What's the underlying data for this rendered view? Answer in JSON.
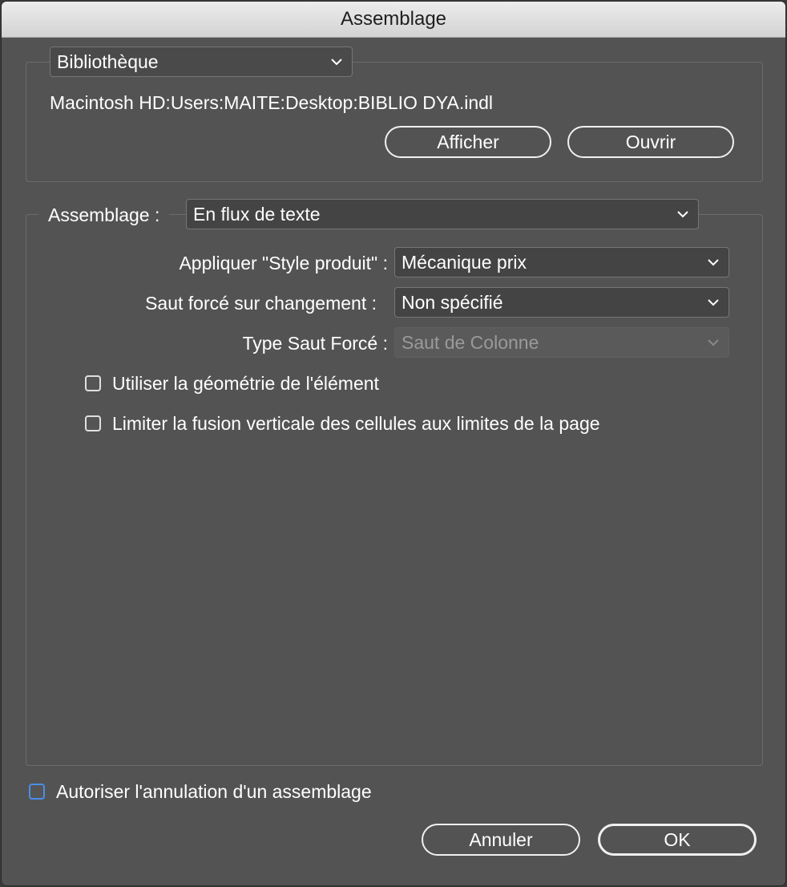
{
  "window": {
    "title": "Assemblage"
  },
  "library": {
    "selector_value": "Bibliothèque",
    "path": "Macintosh HD:Users:MAITE:Desktop:BIBLIO DYA.indl",
    "show_button": "Afficher",
    "open_button": "Ouvrir"
  },
  "assemblage": {
    "label": "Assemblage :",
    "mode_value": "En flux de texte",
    "apply_style_label": "Appliquer \"Style produit\" :",
    "apply_style_value": "Mécanique prix",
    "break_label": "Saut forcé sur changement :",
    "break_value": "Non spécifié",
    "break_type_label": "Type Saut Forcé :",
    "break_type_value": "Saut de Colonne",
    "use_geometry_label": "Utiliser la géométrie de l'élément",
    "limit_merge_label": "Limiter la fusion verticale des cellules aux limites de la page"
  },
  "footer": {
    "allow_undo_label": "Autoriser l'annulation d'un assemblage",
    "cancel_button": "Annuler",
    "ok_button": "OK"
  },
  "icons": {
    "dropdown": "chevron-down-icon"
  },
  "colors": {
    "focus": "#4a8ee8",
    "panel": "#535353",
    "titlebar": "#dcdcdc"
  }
}
